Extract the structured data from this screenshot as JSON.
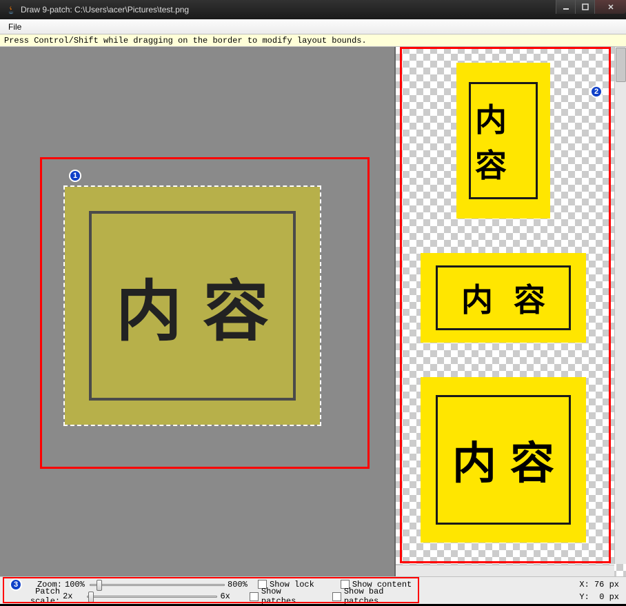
{
  "titlebar": {
    "title": "Draw 9-patch: C:\\Users\\acer\\Pictures\\test.png"
  },
  "menu": {
    "file": "File"
  },
  "hint": "Press Control/Shift while dragging on the border to modify layout bounds.",
  "patch": {
    "content_text": "内容"
  },
  "previews": [
    {
      "content_text": "内容"
    },
    {
      "content_text": "内容"
    },
    {
      "content_text": "内容"
    }
  ],
  "controls": {
    "zoom_label": "Zoom:",
    "zoom_value": "100%",
    "zoom_max": "800%",
    "scale_label": "Patch scale:",
    "scale_value": "2x",
    "scale_max": "6x",
    "show_lock": "Show lock",
    "show_content": "Show content",
    "show_patches": "Show patches",
    "show_bad_patches": "Show bad patches"
  },
  "annotations": {
    "b1": "1",
    "b2": "2",
    "b3": "3"
  },
  "coords": {
    "x_label": "X:",
    "x_value": "76 px",
    "y_label": "Y:",
    "y_value": "0 px"
  }
}
